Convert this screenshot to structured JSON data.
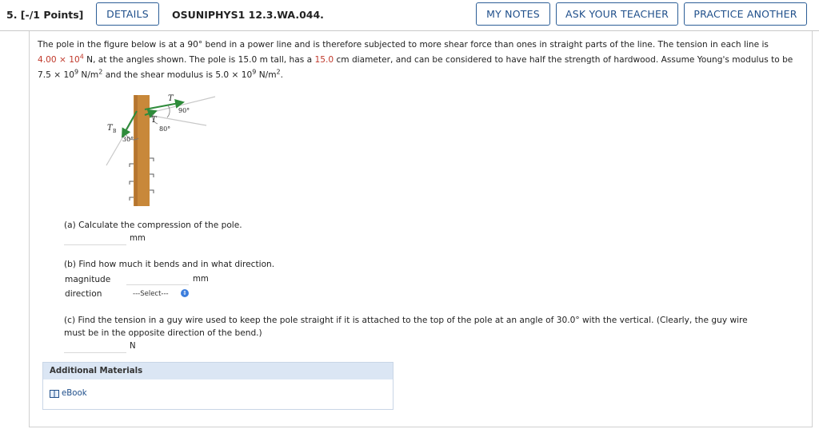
{
  "header": {
    "question_number": "5.  [-/1 Points]",
    "details_label": "DETAILS",
    "assignment_code": "OSUNIPHYS1 12.3.WA.044.",
    "my_notes_label": "MY NOTES",
    "ask_teacher_label": "ASK YOUR TEACHER",
    "practice_another_label": "PRACTICE ANOTHER"
  },
  "problem": {
    "line1": "The pole in the figure below is at a 90° bend in a power line and is therefore subjected to more shear force than ones in straight parts of the line. The tension in each line is",
    "tension_mantissa": "4.00 × 10",
    "tension_exp": "4",
    "line2_after_tension": " N, at the angles shown. The pole is 15.0 m tall, has a ",
    "diameter": "15.0",
    "line2_rest": " cm diameter, and can be considered to have half the strength of hardwood. Assume Young's modulus to be",
    "youngs_mantissa": "7.5 × 10",
    "youngs_exp": "9",
    "youngs_unit_base": " N/m",
    "youngs_unit_exp": "2",
    "shear_text": " and the shear modulus is 5.0 × 10",
    "shear_exp": "9",
    "shear_unit_base": " N/m",
    "shear_unit_exp": "2",
    "period": "."
  },
  "figure": {
    "t_label_top": "T",
    "t_label_mid": "T",
    "tb_label": "T",
    "tb_sub": "B",
    "angle_90": "90°",
    "angle_80": "80°",
    "angle_30": "30°"
  },
  "parts": {
    "a_question": "(a) Calculate the compression of the pole.",
    "a_unit": "mm",
    "b_question": "(b) Find how much it bends and in what direction.",
    "b_magnitude_label": "magnitude",
    "b_magnitude_unit": "mm",
    "b_direction_label": "direction",
    "b_select_value": "---Select---",
    "c_question_line1": "(c) Find the tension in a guy wire used to keep the pole straight if it is attached to the top of the pole at an angle of 30.0° with the vertical. (Clearly, the guy wire",
    "c_question_line2": "must be in the opposite direction of the bend.)",
    "c_unit": "N"
  },
  "additional": {
    "title": "Additional Materials",
    "ebook_label": "eBook"
  },
  "colors": {
    "accent": "#2c5e97",
    "highlight_red": "#c0392b",
    "pole": "#c8883a",
    "arrow_green": "#2e8b3a"
  }
}
